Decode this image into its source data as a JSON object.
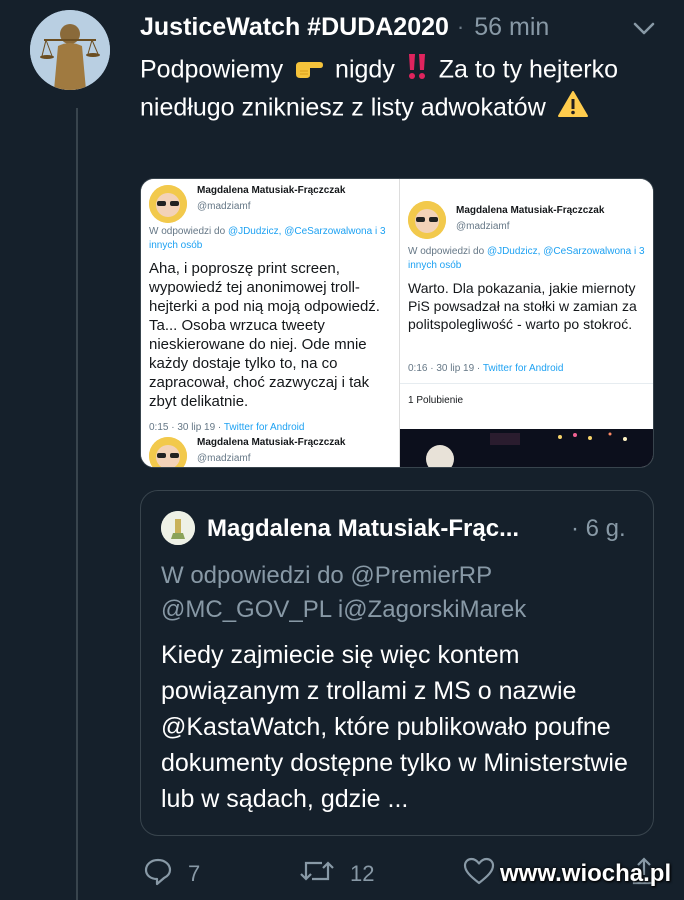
{
  "tweet": {
    "author": "JusticeWatch #DUDA2020",
    "time": "56 min",
    "text_part1": "Podpowiemy",
    "text_part2": "nigdy",
    "text_part3": "Za to ty hejterko niedługo znikniesz z listy adwokatów"
  },
  "media": {
    "left": {
      "name": "Magdalena Matusiak-Frączczak",
      "handle": "@madziamf",
      "reply_prefix": "W odpowiedzi do",
      "reply_links": "@JDudzicz, @CeSarzowalwona i 3 innych osób",
      "body": "Aha, i poproszę print screen, wypowiedź tej anonimowej troll-hejterki a pod nią moją odpowiedź. Ta... Osoba wrzuca tweety nieskierowane do niej. Ode mnie każdy dostaje tylko to, na co zapracował, choć zazwyczaj i tak zbyt delikatnie.",
      "meta": "0:15 · 30 lip 19 ·",
      "meta_link": "Twitter for Android",
      "next_name": "Magdalena Matusiak-Frączczak",
      "next_handle": "@madziamf"
    },
    "right": {
      "name": "Magdalena Matusiak-Frączczak",
      "handle": "@madziamf",
      "reply_prefix": "W odpowiedzi do",
      "reply_links": "@JDudzicz, @CeSarzowalwona i 3 innych osób",
      "body": "Warto. Dla pokazania, jakie miernoty PiS powsadzał na stołki w zamian za politspolegliwość - warto po stokroć.",
      "meta": "0:16 · 30 lip 19 ·",
      "meta_link": "Twitter for Android",
      "likes": "1 Polubienie"
    }
  },
  "quote": {
    "name": "Magdalena Matusiak-Frąc...",
    "time": "· 6 g.",
    "reply": "W odpowiedzi do @PremierRP @MC_GOV_PL i@ZagorskiMarek",
    "body": "Kiedy zajmiecie się więc kontem powiązanym z trollami z MS o nazwie @KastaWatch, które publikowało poufne dokumenty dostępne tylko w Ministerstwie lub w sądach, gdzie ..."
  },
  "actions": {
    "replies": "7",
    "retweets": "12"
  },
  "watermark": "www.wiocha.pl",
  "colors": {
    "background": "#15202b",
    "border": "#38444d",
    "secondary_text": "#8899a6",
    "link": "#1da1f2"
  },
  "icons": [
    "chevron-down-icon",
    "pointing-right-emoji",
    "double-exclamation-emoji",
    "warning-emoji",
    "reply-icon",
    "retweet-icon",
    "like-icon",
    "share-icon"
  ]
}
